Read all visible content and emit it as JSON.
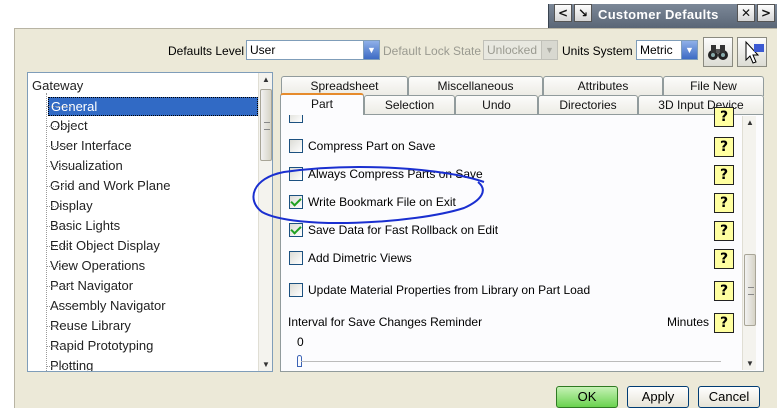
{
  "window": {
    "title": "Customer Defaults",
    "buttons": {
      "back": "<",
      "forward": ">",
      "pin": "↘",
      "close": "✕"
    }
  },
  "toolbar": {
    "defaults_level_label": "Defaults Level",
    "defaults_level_value": "User",
    "lock_state_label": "Default Lock State",
    "lock_state_value": "Unlocked",
    "units_label": "Units System",
    "units_value": "Metric"
  },
  "tree": {
    "root": "Gateway",
    "items": [
      "General",
      "Object",
      "User Interface",
      "Visualization",
      "Grid and Work Plane",
      "Display",
      "Basic Lights",
      "Edit Object Display",
      "View Operations",
      "Part Navigator",
      "Assembly Navigator",
      "Reuse Library",
      "Rapid Prototyping",
      "Plotting"
    ],
    "selected": "General"
  },
  "tabs_back": [
    "Spreadsheet",
    "Miscellaneous",
    "Attributes",
    "File New"
  ],
  "tabs_front": [
    "Part",
    "Selection",
    "Undo",
    "Directories",
    "3D Input Device"
  ],
  "active_tab": "Part",
  "options": [
    {
      "label": "Compress Part on Save",
      "checked": false
    },
    {
      "label": "Always Compress Parts on Save",
      "checked": false
    },
    {
      "label": "Write Bookmark File on Exit",
      "checked": true
    },
    {
      "label": "Save Data for Fast Rollback on Edit",
      "checked": true
    },
    {
      "label": "Add Dimetric Views",
      "checked": false
    },
    {
      "label": "Update Material Properties from Library on Part Load",
      "checked": false
    }
  ],
  "interval": {
    "label": "Interval for Save Changes Reminder",
    "unit": "Minutes",
    "value": "0"
  },
  "help_glyph": "?",
  "footer": {
    "ok": "OK",
    "apply": "Apply",
    "cancel": "Cancel"
  },
  "colors": {
    "accent_tab": "#e68b2c",
    "selection": "#316ac5",
    "annotation": "#1a2fd0"
  }
}
